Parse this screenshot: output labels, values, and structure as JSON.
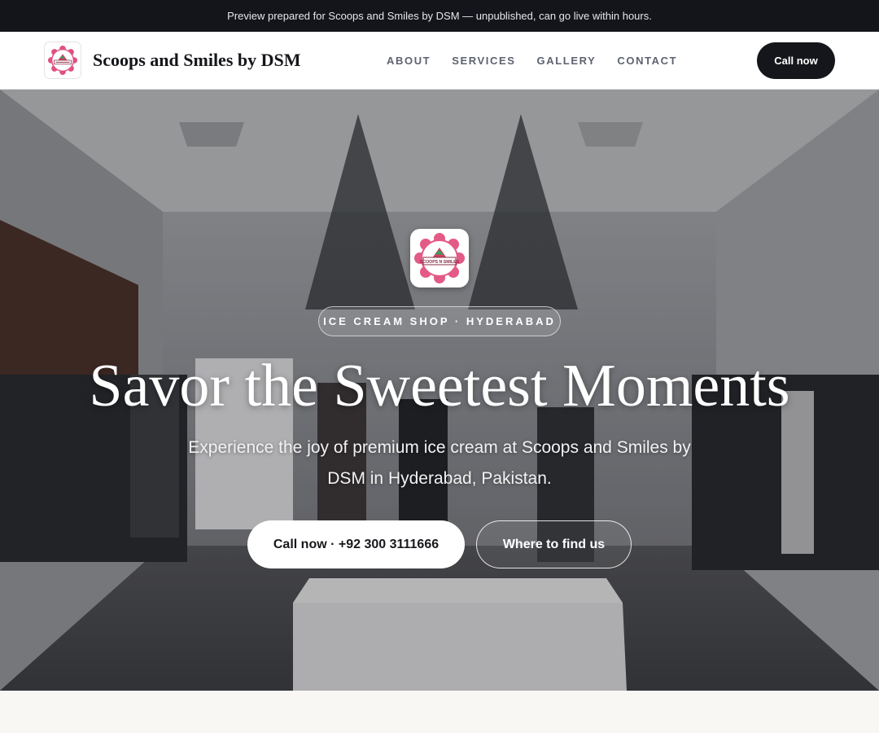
{
  "banner": {
    "text": "Preview prepared for Scoops and Smiles by DSM — unpublished, can go live within hours."
  },
  "header": {
    "brand_name": "Scoops and Smiles by DSM",
    "nav": [
      "ABOUT",
      "SERVICES",
      "GALLERY",
      "CONTACT"
    ],
    "cta_label": "Call now"
  },
  "hero": {
    "tag": "ICE CREAM SHOP · HYDERABAD",
    "headline": "Savor the Sweetest Moments",
    "subtitle": "Experience the joy of premium ice cream at Scoops and Smiles by DSM in Hyderabad, Pakistan.",
    "primary_button": "Call now · +92 300 3111666",
    "secondary_button": "Where to find us",
    "logo_text": "SCOOPS N SMILES"
  },
  "colors": {
    "dark": "#13151b",
    "accent_pink": "#e0507f",
    "white": "#ffffff"
  },
  "icons": {
    "brand_logo": "flower-badge-logo",
    "hero_logo": "flower-badge-logo"
  }
}
